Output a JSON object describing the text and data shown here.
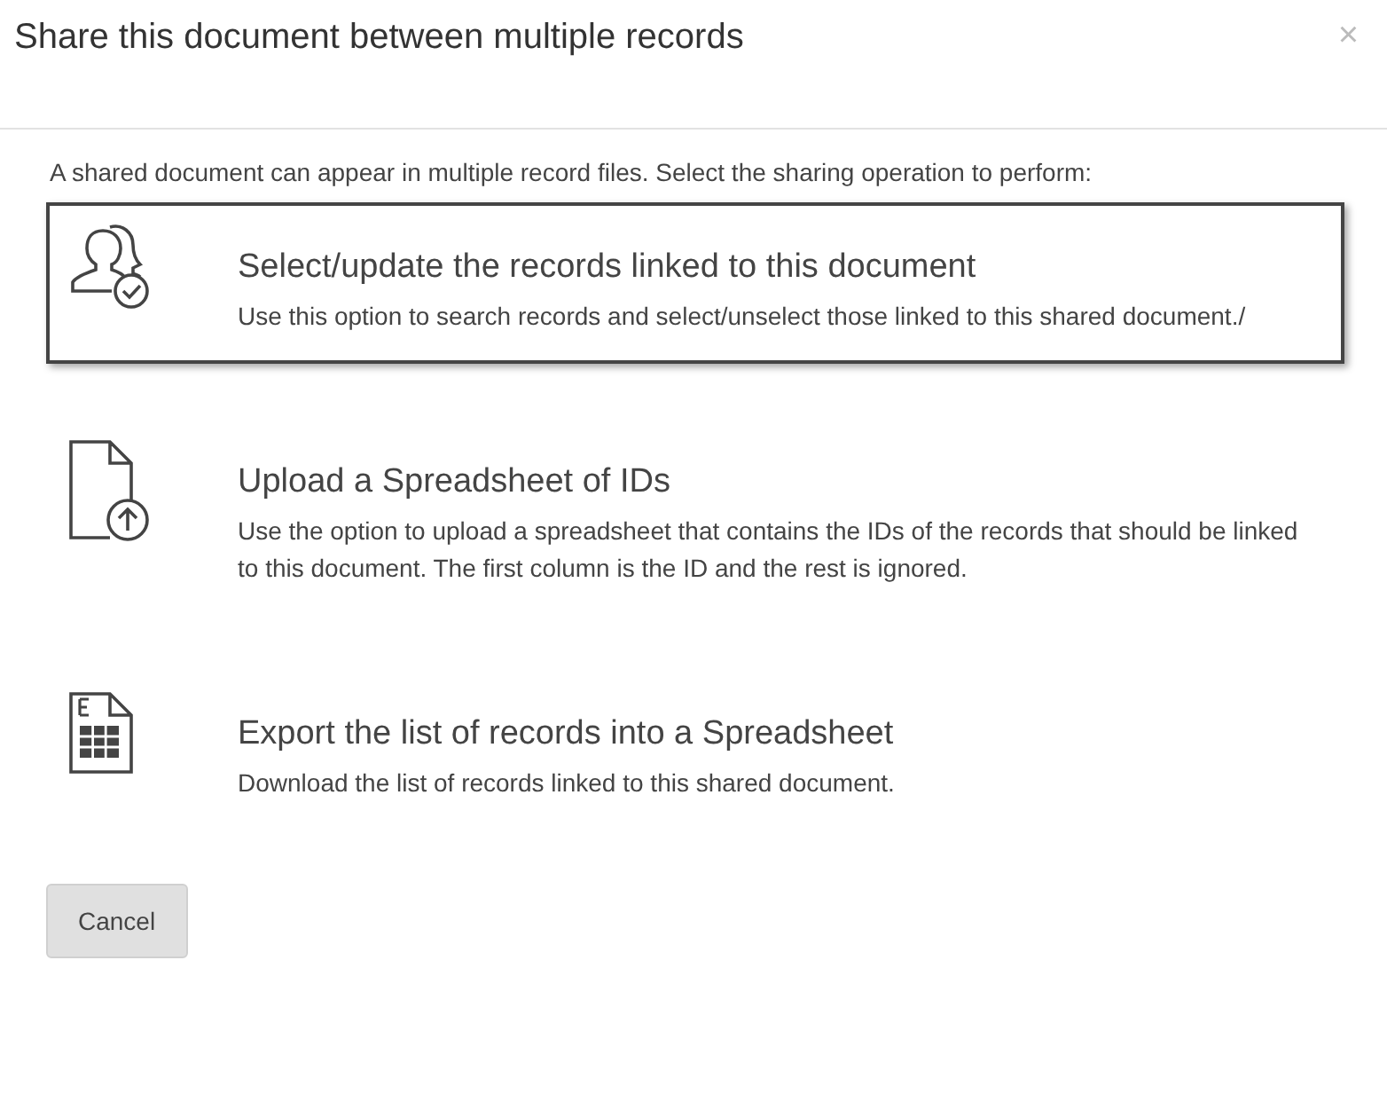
{
  "dialog": {
    "title": "Share this document between multiple records",
    "close": "×",
    "intro": "A shared document can appear in multiple record files. Select the sharing operation to perform:",
    "options": [
      {
        "kind": "link",
        "title": "Select/update the records linked to this document",
        "description": "Use this option to search records and select/unselect those linked to this shared document./",
        "selected": true
      },
      {
        "kind": "upload",
        "title": "Upload a Spreadsheet of IDs",
        "description": "Use the option to upload a spreadsheet that contains the IDs of the records that should be linked to this document. The first column is the ID and the rest is ignored.",
        "selected": false
      },
      {
        "kind": "export",
        "title": "Export the list of records into a Spreadsheet",
        "description": "Download the list of records linked to this shared document.",
        "selected": false
      }
    ],
    "buttons": [
      "Cancel"
    ]
  }
}
